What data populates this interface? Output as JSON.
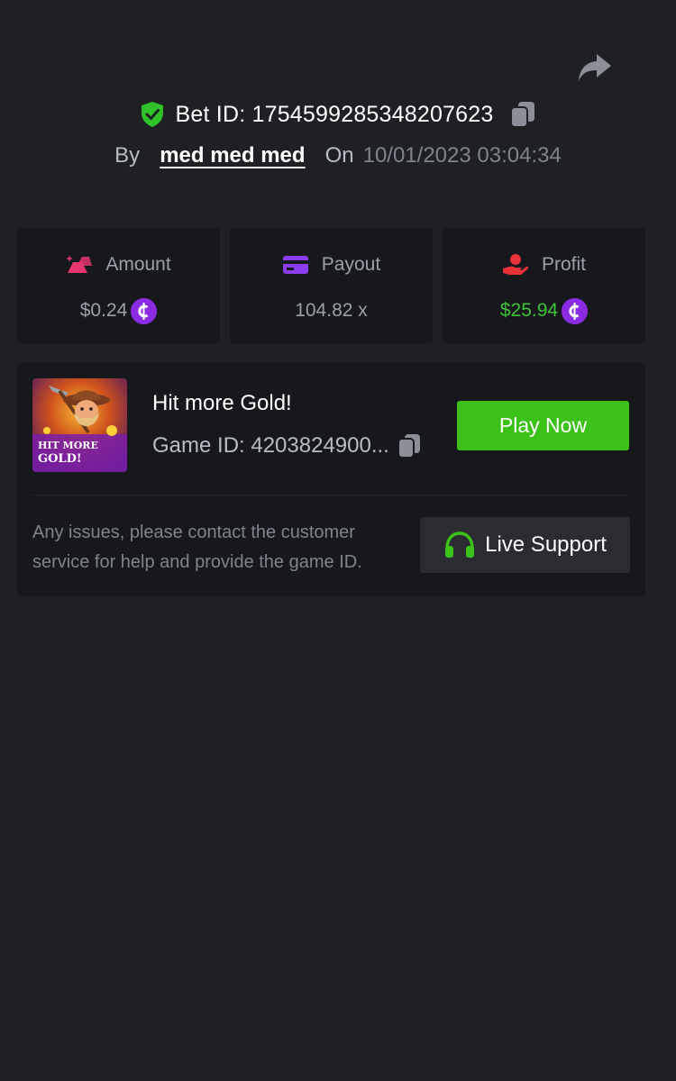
{
  "header": {
    "share_icon": "share-arrow-icon",
    "bet_id_label": "Bet ID: 1754599285348207623",
    "by_label": "By",
    "username": "med med med",
    "on_label": "On",
    "datetime": "10/01/2023 03:04:34"
  },
  "stats": [
    {
      "label": "Amount",
      "value": "$0.24",
      "icon": "gold-bars-icon",
      "icon_color": "#e6356f",
      "coin": true
    },
    {
      "label": "Payout",
      "value": "104.82 x",
      "icon": "card-icon",
      "icon_color": "#8b3ef0",
      "coin": false
    },
    {
      "label": "Profit",
      "value": "$25.94",
      "icon": "hand-money-icon",
      "icon_color": "#e8323a",
      "coin": true
    }
  ],
  "game": {
    "title": "Hit more Gold!",
    "game_id": "Game ID: 4203824900...",
    "thumb_text_line1": "HIT MORE",
    "thumb_text_line2": "GOLD!",
    "play_label": "Play Now"
  },
  "support": {
    "help_text": "Any issues, please contact the customer service for help and provide the game ID.",
    "button_label": "Live Support"
  },
  "colors": {
    "background": "#1f2024",
    "card": "#17181b",
    "accent_green": "#3bc117",
    "profit_green": "#3fc33a",
    "coin_purple": "#8a2be2"
  }
}
